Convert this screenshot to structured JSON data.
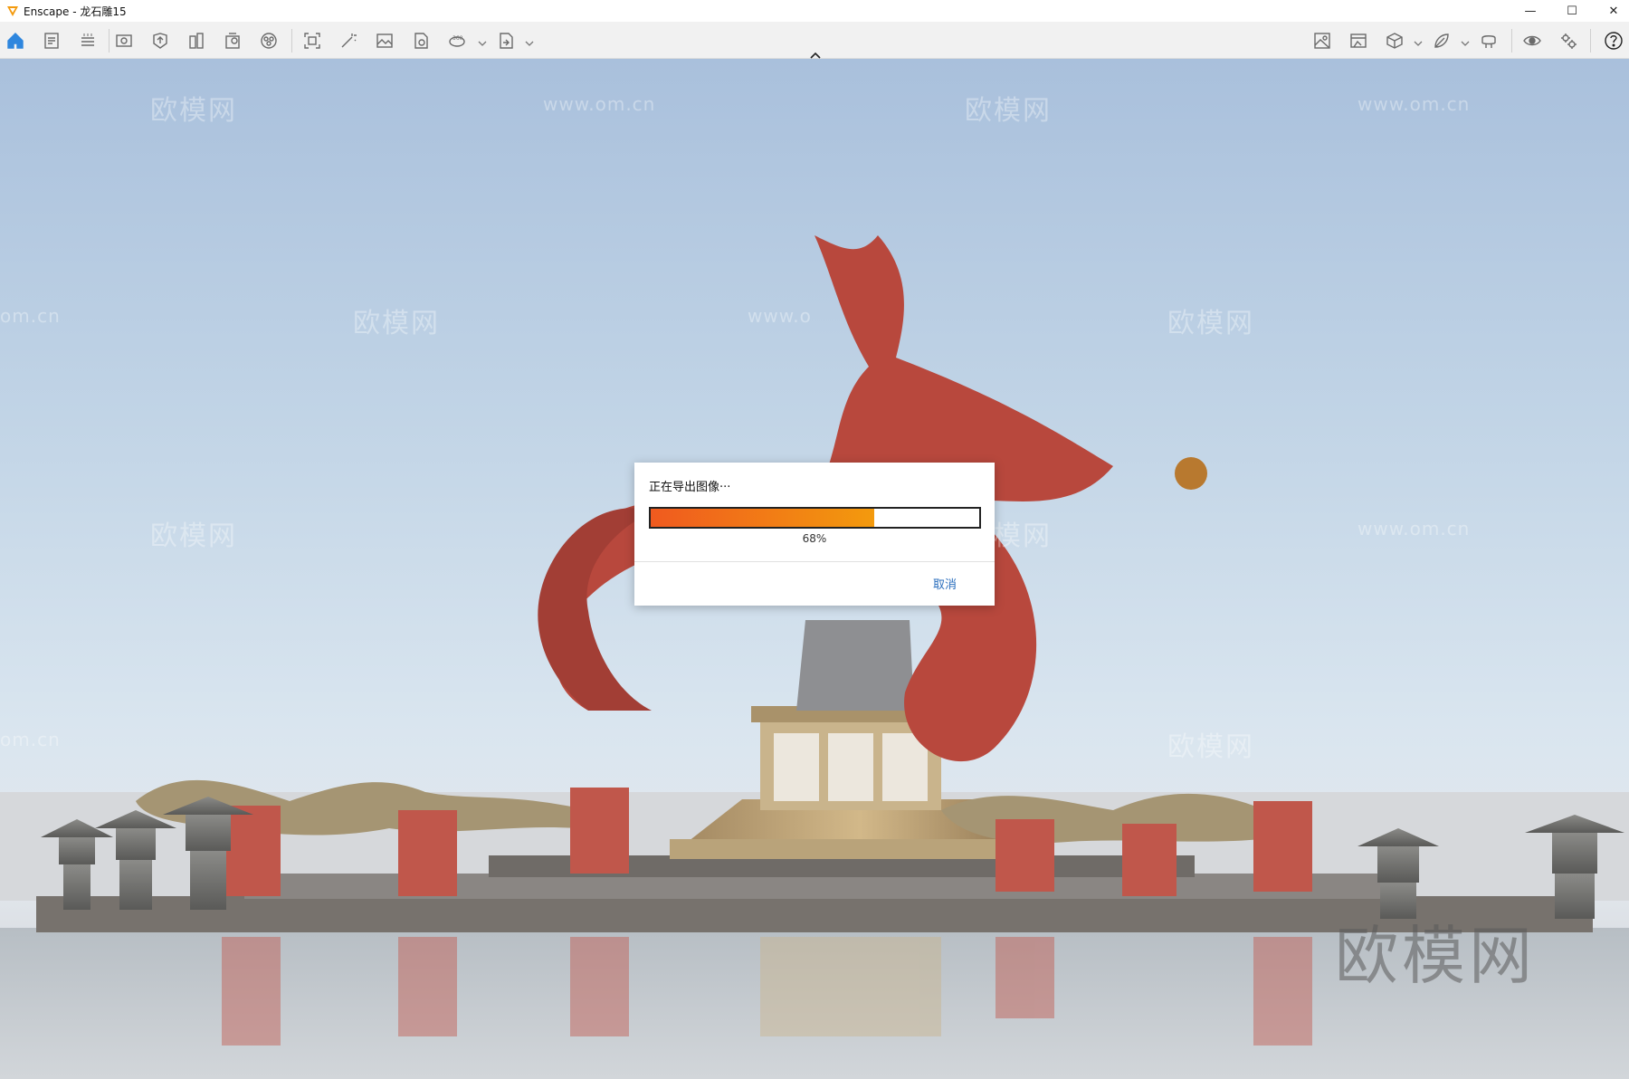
{
  "window": {
    "app_name": "Enscape - 龙石雕15",
    "controls": {
      "minimize": "—",
      "maximize": "☐",
      "close": "✕"
    }
  },
  "toolbar": {
    "left_icons": [
      "home-icon",
      "document-icon",
      "bim-icon",
      "visual-settings-icon",
      "upload-icon",
      "views-icon",
      "project-icon",
      "asset-library-icon",
      "screenshot-icon",
      "magic-icon",
      "image-icon",
      "batch-render-icon",
      "panorama-360-icon",
      "export-file-icon"
    ],
    "right_icons": [
      "image-compare-icon",
      "gallery-icon",
      "cube-icon",
      "material-editor-icon",
      "vr-headset-icon",
      "visibility-icon",
      "settings-icon",
      "help-icon"
    ],
    "active_icon": "home-icon",
    "accent_color": "#2e86de"
  },
  "watermarks": {
    "brand": "欧模网",
    "url": "www.om.cn",
    "url_partial": "om.cn",
    "url_partial_left": "www.o"
  },
  "export_dialog": {
    "title": "正在导出图像···",
    "progress": 0.68,
    "progress_text": "68%",
    "cancel_label": "取消",
    "progress_colors": [
      "#f05a1f",
      "#f39a0d"
    ]
  }
}
